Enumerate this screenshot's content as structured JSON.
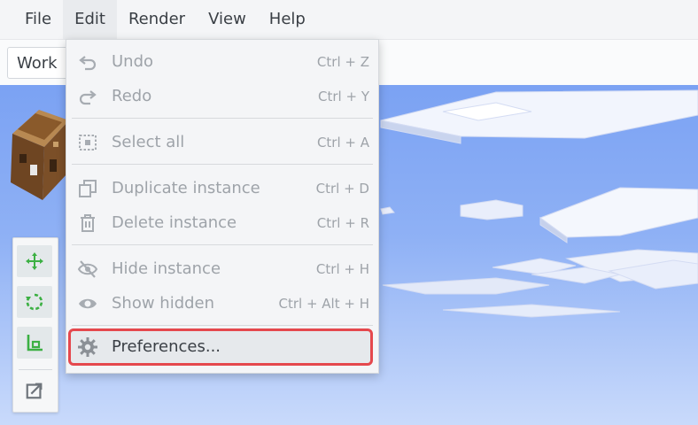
{
  "menubar": {
    "items": [
      {
        "label": "File"
      },
      {
        "label": "Edit"
      },
      {
        "label": "Render"
      },
      {
        "label": "View"
      },
      {
        "label": "Help"
      }
    ]
  },
  "toolbar": {
    "workbench_label": "Work"
  },
  "edit_menu": {
    "undo": {
      "label": "Undo",
      "shortcut": "Ctrl + Z",
      "icon": "undo-icon"
    },
    "redo": {
      "label": "Redo",
      "shortcut": "Ctrl + Y",
      "icon": "redo-icon"
    },
    "select_all": {
      "label": "Select all",
      "shortcut": "Ctrl + A",
      "icon": "select-all-icon"
    },
    "duplicate": {
      "label": "Duplicate instance",
      "shortcut": "Ctrl + D",
      "icon": "duplicate-icon"
    },
    "delete": {
      "label": "Delete instance",
      "shortcut": "Ctrl + R",
      "icon": "trash-icon"
    },
    "hide": {
      "label": "Hide instance",
      "shortcut": "Ctrl + H",
      "icon": "eye-off-icon"
    },
    "show_hidden": {
      "label": "Show hidden",
      "shortcut": "Ctrl + Alt + H",
      "icon": "eye-icon"
    },
    "preferences": {
      "label": "Preferences...",
      "icon": "gear-icon"
    }
  },
  "palette": {
    "tools": [
      "move-icon",
      "rotate-icon",
      "scale-icon",
      "export-icon"
    ]
  },
  "colors": {
    "highlight": "#e5484d",
    "tool_green": "#3cb043",
    "sky_top": "#7ba2f3",
    "sky_bottom": "#c9dafb"
  }
}
